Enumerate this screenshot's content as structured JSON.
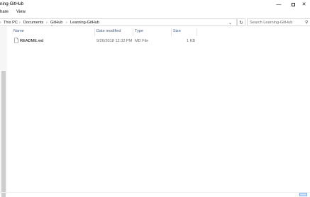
{
  "window": {
    "title": "ning-GitHub",
    "minimize_icon": "minimize-icon",
    "maximize_icon": "maximize-icon",
    "close_icon": "close-icon"
  },
  "ribbon": {
    "tabs": [
      "hare",
      "View"
    ]
  },
  "address": {
    "crumbs": [
      "This PC",
      "Documents",
      "GitHub",
      "Learning-GitHub"
    ],
    "separator": "›"
  },
  "search": {
    "placeholder": "Search Learning-GitHub"
  },
  "columns": {
    "name": "Name",
    "date_modified": "Date modified",
    "type": "Type",
    "size": "Size"
  },
  "files": [
    {
      "name": "README.md",
      "date_modified": "9/26/2018 12:32 PM",
      "type": "MD File",
      "size": "1 KB",
      "icon": "document-icon"
    }
  ],
  "colors": {
    "header_text": "#4d6082",
    "selection": "#cce8ff",
    "border": "#d9d9d9"
  }
}
